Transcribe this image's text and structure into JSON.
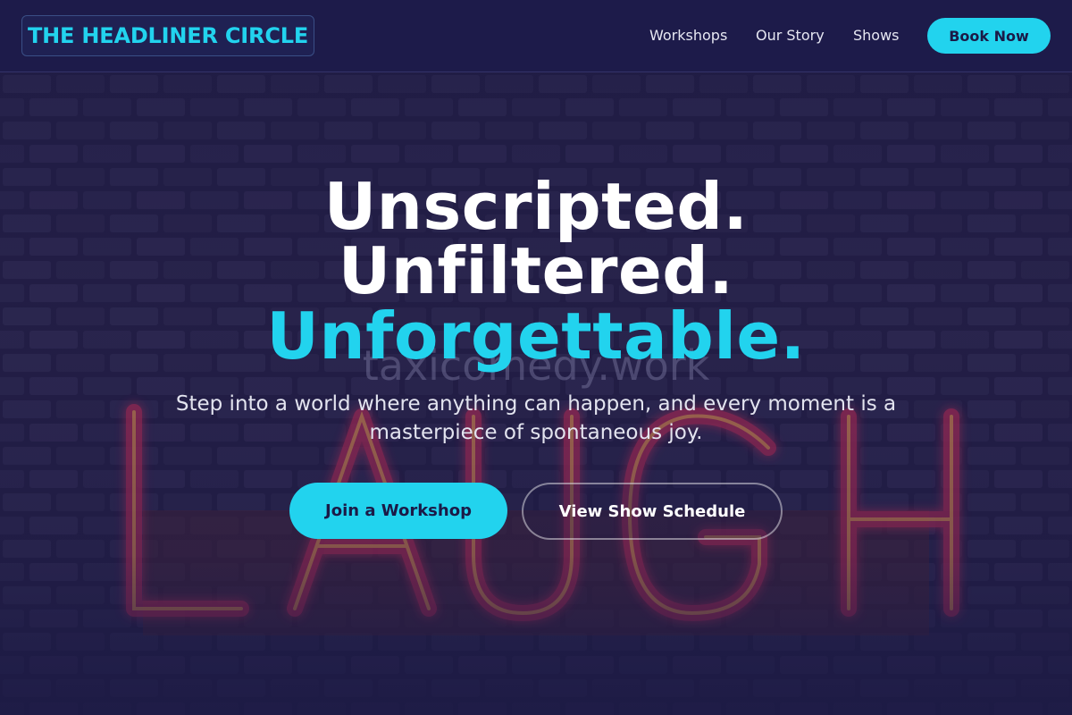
{
  "header": {
    "logo": "THE HEADLINER CIRCLE",
    "nav": [
      "Workshops",
      "Our Story",
      "Shows"
    ],
    "cta": "Book Now"
  },
  "hero": {
    "background": "neon-laugh-sign-brick-wall-image",
    "watermark": "taxicomedy.work",
    "headline": [
      "Unscripted.",
      "Unfiltered.",
      "Unforgettable."
    ],
    "subtitle": "Step into a world where anything can happen, and every moment is a masterpiece of spontaneous joy.",
    "primary_button": "Join a Workshop",
    "secondary_button": "View Show Schedule"
  },
  "colors": {
    "accent": "#22d3ee",
    "background": "#1c1a45",
    "text": "#ffffff"
  }
}
